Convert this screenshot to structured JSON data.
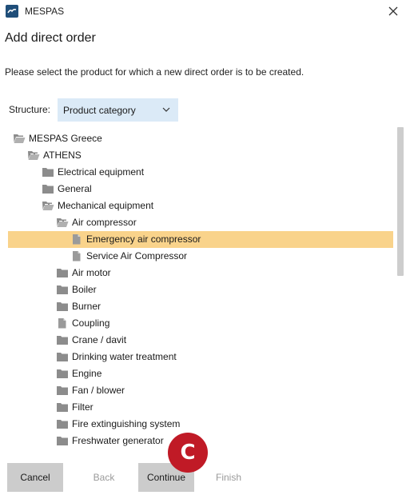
{
  "app": {
    "title": "MESPAS",
    "logo_icon": "mespas-logo-icon",
    "close_icon": "close-icon"
  },
  "dialog": {
    "title": "Add direct order",
    "instructions": "Please select the product for which a new direct order is to be created."
  },
  "structure": {
    "label": "Structure:",
    "selected": "Product category"
  },
  "tree": {
    "rows": [
      {
        "label": "MESPAS Greece",
        "depth": 0,
        "expander": "none",
        "icon": "folder-open",
        "selected": false
      },
      {
        "label": "ATHENS",
        "depth": 1,
        "expander": "expanded",
        "icon": "folder-open",
        "selected": false
      },
      {
        "label": "Electrical equipment",
        "depth": 2,
        "expander": "collapsed",
        "icon": "folder",
        "selected": false
      },
      {
        "label": "General",
        "depth": 2,
        "expander": "collapsed",
        "icon": "folder",
        "selected": false
      },
      {
        "label": "Mechanical equipment",
        "depth": 2,
        "expander": "expanded",
        "icon": "folder-open",
        "selected": false
      },
      {
        "label": "Air compressor",
        "depth": 3,
        "expander": "expanded",
        "icon": "folder-open",
        "selected": false
      },
      {
        "label": "Emergency air compressor",
        "depth": 4,
        "expander": "none",
        "icon": "document",
        "selected": true
      },
      {
        "label": "Service Air Compressor",
        "depth": 4,
        "expander": "none",
        "icon": "document",
        "selected": false
      },
      {
        "label": "Air motor",
        "depth": 3,
        "expander": "collapsed",
        "icon": "folder",
        "selected": false
      },
      {
        "label": "Boiler",
        "depth": 3,
        "expander": "collapsed",
        "icon": "folder",
        "selected": false
      },
      {
        "label": "Burner",
        "depth": 3,
        "expander": "collapsed",
        "icon": "folder",
        "selected": false
      },
      {
        "label": "Coupling",
        "depth": 3,
        "expander": "none",
        "icon": "document",
        "selected": false
      },
      {
        "label": "Crane / davit",
        "depth": 3,
        "expander": "collapsed",
        "icon": "folder",
        "selected": false
      },
      {
        "label": "Drinking water treatment",
        "depth": 3,
        "expander": "collapsed",
        "icon": "folder",
        "selected": false
      },
      {
        "label": "Engine",
        "depth": 3,
        "expander": "collapsed",
        "icon": "folder",
        "selected": false
      },
      {
        "label": "Fan / blower",
        "depth": 3,
        "expander": "collapsed",
        "icon": "folder",
        "selected": false
      },
      {
        "label": "Filter",
        "depth": 3,
        "expander": "collapsed",
        "icon": "folder",
        "selected": false
      },
      {
        "label": "Fire extinguishing system",
        "depth": 3,
        "expander": "collapsed",
        "icon": "folder",
        "selected": false
      },
      {
        "label": "Freshwater generator",
        "depth": 3,
        "expander": "collapsed",
        "icon": "folder",
        "selected": false
      }
    ]
  },
  "buttons": {
    "cancel": "Cancel",
    "back": "Back",
    "continue": "Continue",
    "finish": "Finish"
  },
  "callout": {
    "letter": "C"
  },
  "colors": {
    "selection": "#f9d38b",
    "select_bg": "#dbeaf7",
    "button_bg": "#cccccc",
    "callout": "#c01a26"
  }
}
